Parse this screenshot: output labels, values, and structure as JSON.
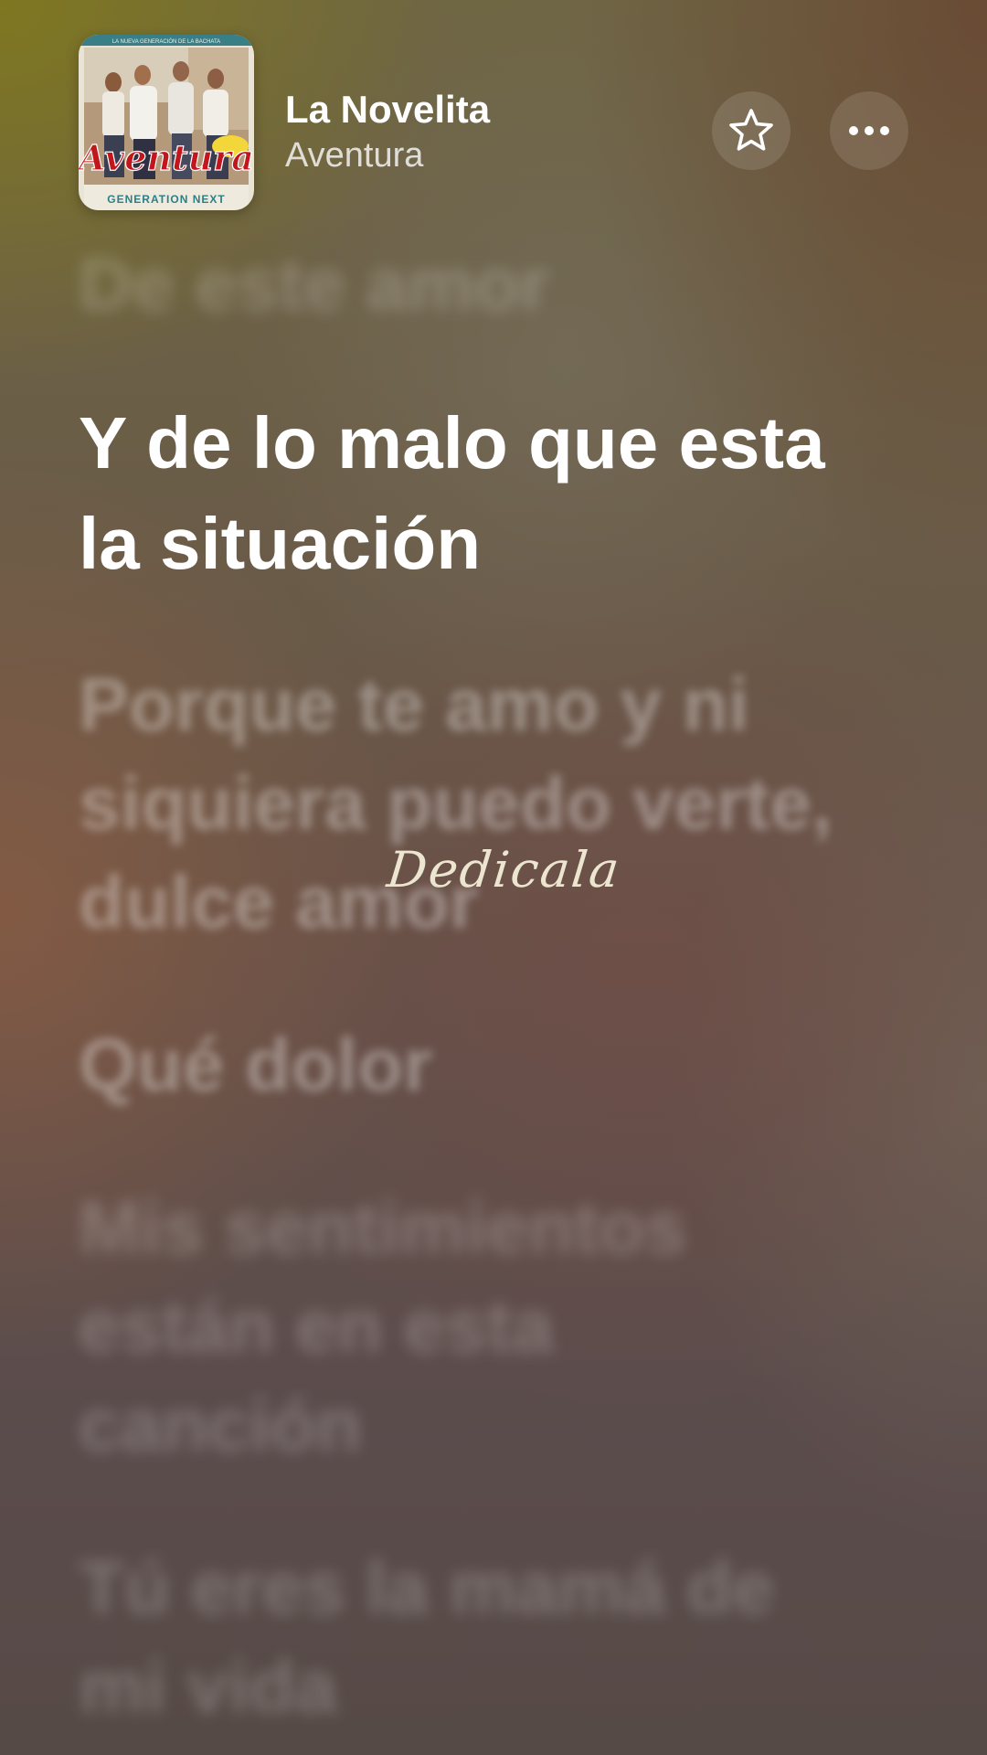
{
  "now_playing": {
    "title": "La Novelita",
    "artist": "Aventura",
    "album_art": {
      "top_banner": "LA NUEVA GENERACIÓN DE LA BACHATA",
      "band_logo": "Aventura",
      "subtitle": "GENERATION NEXT"
    }
  },
  "actions": {
    "favorite_icon": "star-outline-icon",
    "more_icon": "ellipsis-icon"
  },
  "lyrics": {
    "previous": "De este amor",
    "current": "Y de lo malo que esta\nla situación",
    "upcoming": [
      "Porque te amo y ni\nsiquiera puedo verte,\ndulce amor",
      "Qué dolor",
      "Mis sentimientos\nestán en esta\ncanción",
      "Tú eres la mamá de\nmi vida"
    ]
  },
  "watermark": "Dedicala",
  "colors": {
    "active_lyric": "#ffffff",
    "dim_lyric": "rgba(255,255,255,0.34)",
    "background_top_left": "#807820",
    "background_bottom": "#564a46"
  }
}
